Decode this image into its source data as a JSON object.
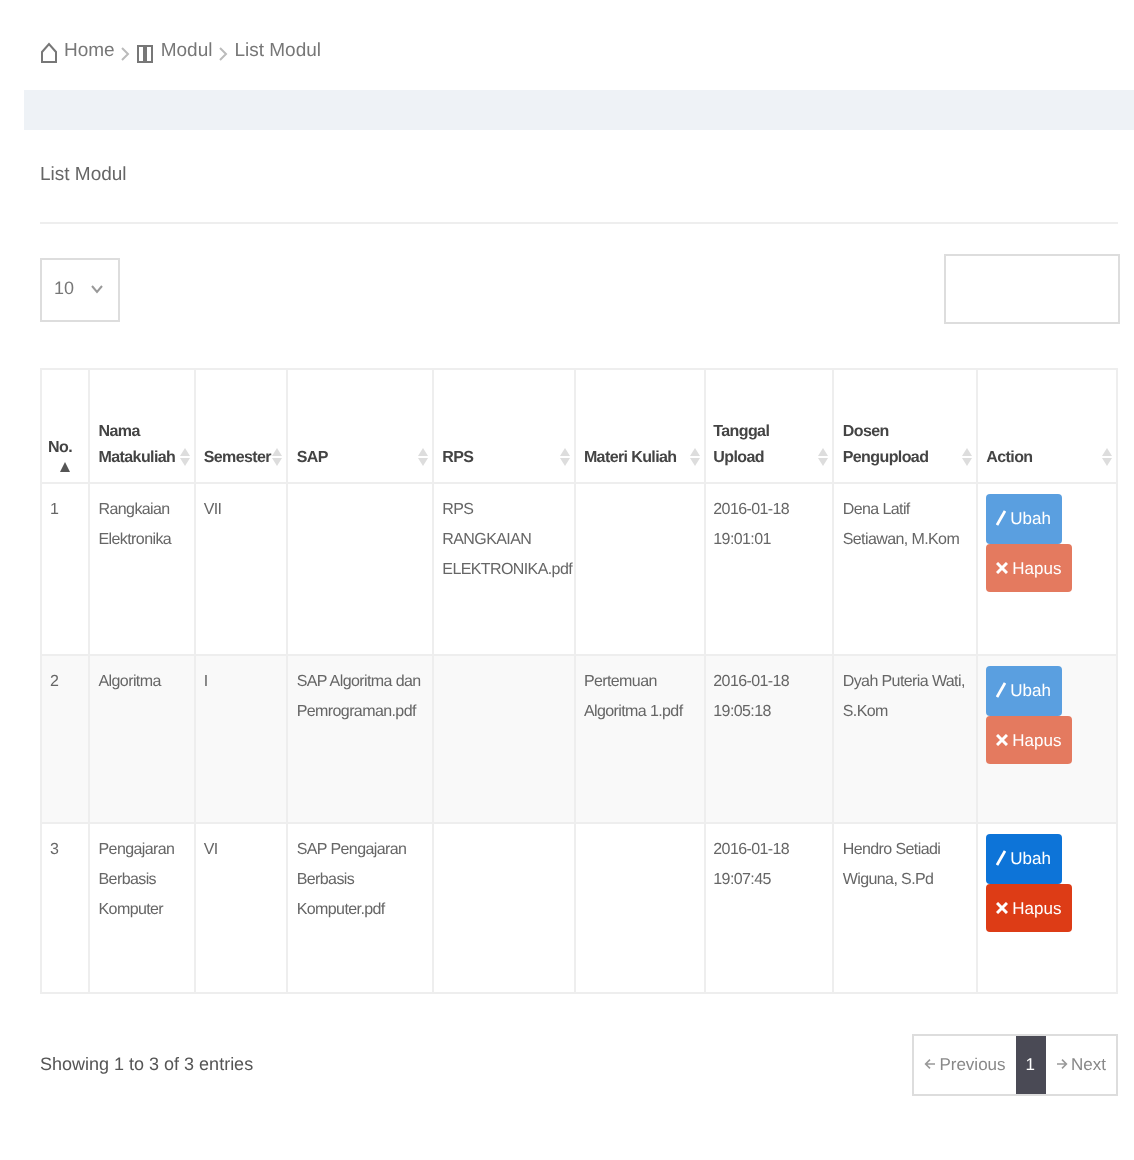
{
  "breadcrumb": [
    {
      "label": "Home"
    },
    {
      "label": "Modul"
    },
    {
      "label": "List Modul"
    }
  ],
  "card_title": "List Modul",
  "length_select": {
    "value": "10"
  },
  "table": {
    "columns": [
      {
        "label": "No.",
        "sorted": true
      },
      {
        "label": "Nama Matakuliah",
        "sorted": false
      },
      {
        "label": "Semester",
        "sorted": false
      },
      {
        "label": "SAP",
        "sorted": false
      },
      {
        "label": "RPS",
        "sorted": false
      },
      {
        "label": "Materi Kuliah",
        "sorted": false
      },
      {
        "label": "Tanggal Upload",
        "sorted": false
      },
      {
        "label": "Dosen Pengupload",
        "sorted": false
      },
      {
        "label": "Action",
        "sorted": false
      }
    ],
    "rows": [
      {
        "cells": [
          "1",
          "Rangkaian Elektronika",
          "VII",
          "",
          "RPS RANGKAIAN ELEKTRONIKA.pdf",
          "",
          "2016-01-18 19:01:01",
          "Dena Latif Setiawan, M.Kom"
        ],
        "edit": "Ubah",
        "delete": "Hapus",
        "faded": true
      },
      {
        "cells": [
          "2",
          "Algoritma",
          "I",
          "SAP Algoritma dan Pemrograman.pdf",
          "",
          "Pertemuan Algoritma 1.pdf",
          "2016-01-18 19:05:18",
          "Dyah Puteria Wati, S.Kom"
        ],
        "edit": "Ubah",
        "delete": "Hapus",
        "faded": true
      },
      {
        "cells": [
          "3",
          "Pengajaran Berbasis Komputer",
          "VI",
          "SAP Pengajaran Berbasis Komputer.pdf",
          "",
          "",
          "2016-01-18 19:07:45",
          "Hendro Setiadi Wiguna, S.Pd"
        ],
        "edit": "Ubah",
        "delete": "Hapus",
        "faded": false
      }
    ]
  },
  "info": "Showing 1 to 3 of 3 entries",
  "pagination": [
    {
      "label": "Previous",
      "kind": "prev",
      "selected": false
    },
    {
      "label": "1",
      "kind": "page",
      "selected": true
    },
    {
      "label": "Next",
      "kind": "next",
      "selected": false
    }
  ]
}
